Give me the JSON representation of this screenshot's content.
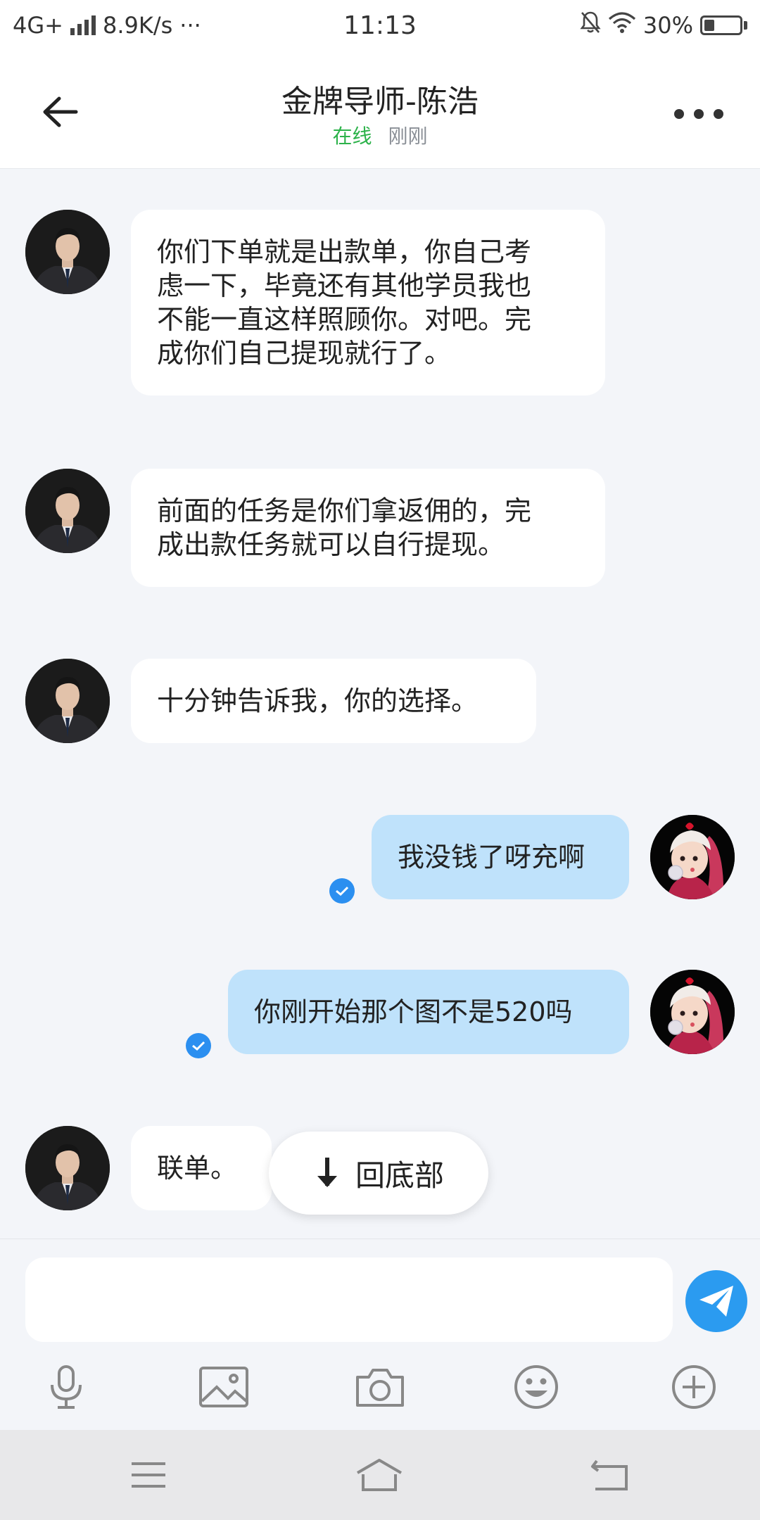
{
  "status_bar": {
    "network": "4G+",
    "speed": "8.9K/s",
    "dots": "···",
    "time": "11:13",
    "battery": "30%"
  },
  "header": {
    "title": "金牌导师-陈浩",
    "status": "在线",
    "last_seen": "刚刚"
  },
  "messages": [
    {
      "direction": "in",
      "text": "你们下单就是出款单，你自己考虑一下，毕竟还有其他学员我也不能一直这样照顾你。对吧。完成你们自己提现就行了。",
      "lines": [
        "你们下单就是出款单，你自己考",
        "虑一下，毕竟还有其他学员我也",
        "不能一直这样照顾你。对吧。完",
        "成你们自己提现就行了。"
      ]
    },
    {
      "direction": "in",
      "text": "前面的任务是你们拿返佣的，完成出款任务就可以自行提现。",
      "lines": [
        "前面的任务是你们拿返佣的，完",
        "成出款任务就可以自行提现。"
      ]
    },
    {
      "direction": "in",
      "text": "十分钟告诉我，你的选择。",
      "lines": [
        "十分钟告诉我，你的选择。"
      ]
    },
    {
      "direction": "out",
      "text": "我没钱了呀充啊",
      "lines": [
        "我没钱了呀充啊"
      ],
      "read": true
    },
    {
      "direction": "out",
      "text": "你刚开始那个图不是520吗",
      "lines": [
        "你刚开始那个图不是520吗"
      ],
      "read": true
    },
    {
      "direction": "in",
      "text": "联单。",
      "lines": [
        "联单。"
      ]
    }
  ],
  "scroll_button": {
    "label": "回底部"
  },
  "composer": {
    "placeholder": ""
  },
  "colors": {
    "online": "#2cb24a",
    "outgoing_bubble": "#bfe2fb",
    "send_button": "#2b9bf0",
    "read_check": "#2b8ff0"
  },
  "toolbar_icons": [
    "microphone-icon",
    "image-icon",
    "camera-icon",
    "emoji-icon",
    "plus-icon"
  ],
  "nav_icons": [
    "menu-icon",
    "home-icon",
    "back-icon"
  ]
}
